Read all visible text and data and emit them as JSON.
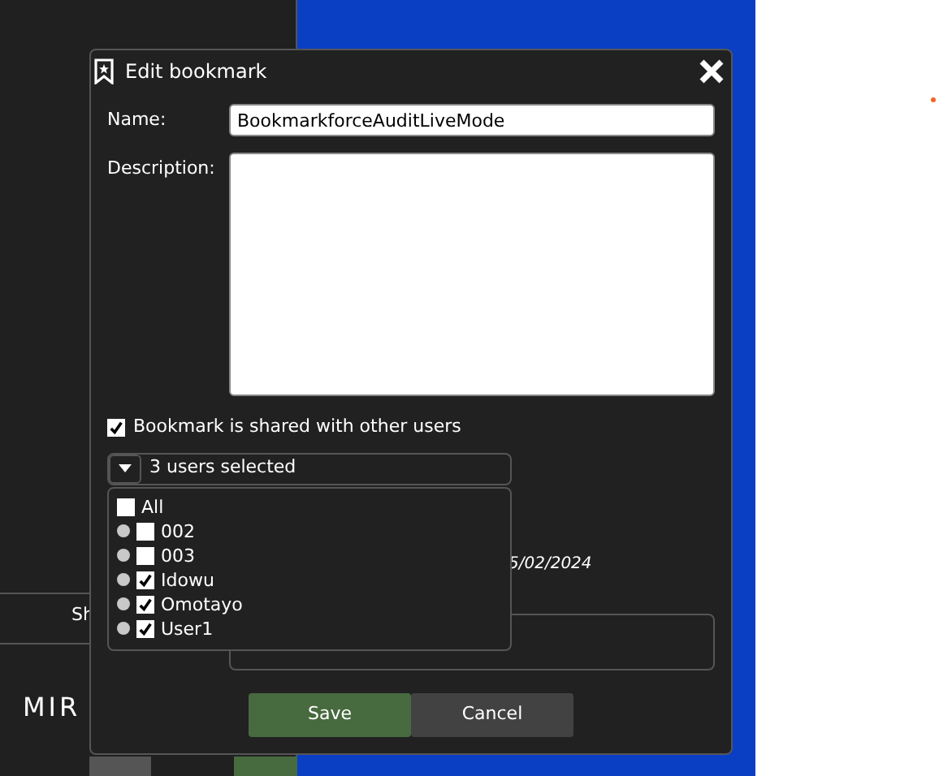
{
  "background": {
    "side_label": "Sh",
    "logo": "MIR"
  },
  "dialog": {
    "title": "Edit bookmark",
    "name": {
      "label": "Name:",
      "value": "BookmarkforceAuditLiveMode"
    },
    "description": {
      "label": "Description:"
    },
    "shared": {
      "label": "Bookmark is shared with other users",
      "checked": true
    },
    "users": {
      "summary": "3 users selected",
      "expanded": true,
      "all": {
        "label": "All",
        "checked": false
      },
      "items": [
        {
          "label": "002",
          "checked": false
        },
        {
          "label": "003",
          "checked": false
        },
        {
          "label": "Idowu",
          "checked": true
        },
        {
          "label": "Omotayo",
          "checked": true
        },
        {
          "label": "User1",
          "checked": true
        }
      ]
    },
    "date": "5/02/2024",
    "buttons": [
      {
        "label": "Save",
        "kind": "primary"
      },
      {
        "label": "Cancel",
        "kind": "secondary"
      }
    ]
  }
}
